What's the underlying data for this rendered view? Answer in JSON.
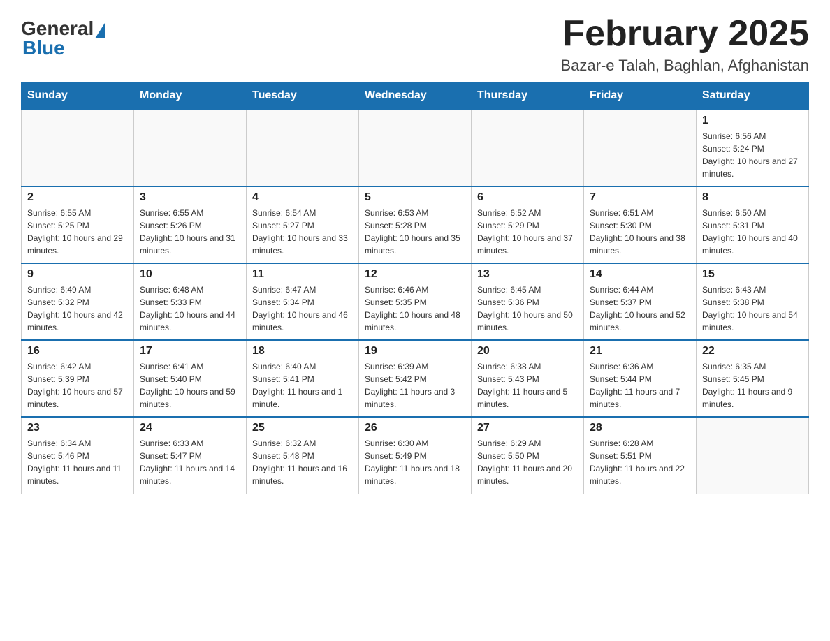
{
  "header": {
    "logo": {
      "general": "General",
      "blue": "Blue"
    },
    "title": "February 2025",
    "location": "Bazar-e Talah, Baghlan, Afghanistan"
  },
  "days_of_week": [
    "Sunday",
    "Monday",
    "Tuesday",
    "Wednesday",
    "Thursday",
    "Friday",
    "Saturday"
  ],
  "weeks": [
    [
      {
        "day": "",
        "info": ""
      },
      {
        "day": "",
        "info": ""
      },
      {
        "day": "",
        "info": ""
      },
      {
        "day": "",
        "info": ""
      },
      {
        "day": "",
        "info": ""
      },
      {
        "day": "",
        "info": ""
      },
      {
        "day": "1",
        "info": "Sunrise: 6:56 AM\nSunset: 5:24 PM\nDaylight: 10 hours and 27 minutes."
      }
    ],
    [
      {
        "day": "2",
        "info": "Sunrise: 6:55 AM\nSunset: 5:25 PM\nDaylight: 10 hours and 29 minutes."
      },
      {
        "day": "3",
        "info": "Sunrise: 6:55 AM\nSunset: 5:26 PM\nDaylight: 10 hours and 31 minutes."
      },
      {
        "day": "4",
        "info": "Sunrise: 6:54 AM\nSunset: 5:27 PM\nDaylight: 10 hours and 33 minutes."
      },
      {
        "day": "5",
        "info": "Sunrise: 6:53 AM\nSunset: 5:28 PM\nDaylight: 10 hours and 35 minutes."
      },
      {
        "day": "6",
        "info": "Sunrise: 6:52 AM\nSunset: 5:29 PM\nDaylight: 10 hours and 37 minutes."
      },
      {
        "day": "7",
        "info": "Sunrise: 6:51 AM\nSunset: 5:30 PM\nDaylight: 10 hours and 38 minutes."
      },
      {
        "day": "8",
        "info": "Sunrise: 6:50 AM\nSunset: 5:31 PM\nDaylight: 10 hours and 40 minutes."
      }
    ],
    [
      {
        "day": "9",
        "info": "Sunrise: 6:49 AM\nSunset: 5:32 PM\nDaylight: 10 hours and 42 minutes."
      },
      {
        "day": "10",
        "info": "Sunrise: 6:48 AM\nSunset: 5:33 PM\nDaylight: 10 hours and 44 minutes."
      },
      {
        "day": "11",
        "info": "Sunrise: 6:47 AM\nSunset: 5:34 PM\nDaylight: 10 hours and 46 minutes."
      },
      {
        "day": "12",
        "info": "Sunrise: 6:46 AM\nSunset: 5:35 PM\nDaylight: 10 hours and 48 minutes."
      },
      {
        "day": "13",
        "info": "Sunrise: 6:45 AM\nSunset: 5:36 PM\nDaylight: 10 hours and 50 minutes."
      },
      {
        "day": "14",
        "info": "Sunrise: 6:44 AM\nSunset: 5:37 PM\nDaylight: 10 hours and 52 minutes."
      },
      {
        "day": "15",
        "info": "Sunrise: 6:43 AM\nSunset: 5:38 PM\nDaylight: 10 hours and 54 minutes."
      }
    ],
    [
      {
        "day": "16",
        "info": "Sunrise: 6:42 AM\nSunset: 5:39 PM\nDaylight: 10 hours and 57 minutes."
      },
      {
        "day": "17",
        "info": "Sunrise: 6:41 AM\nSunset: 5:40 PM\nDaylight: 10 hours and 59 minutes."
      },
      {
        "day": "18",
        "info": "Sunrise: 6:40 AM\nSunset: 5:41 PM\nDaylight: 11 hours and 1 minute."
      },
      {
        "day": "19",
        "info": "Sunrise: 6:39 AM\nSunset: 5:42 PM\nDaylight: 11 hours and 3 minutes."
      },
      {
        "day": "20",
        "info": "Sunrise: 6:38 AM\nSunset: 5:43 PM\nDaylight: 11 hours and 5 minutes."
      },
      {
        "day": "21",
        "info": "Sunrise: 6:36 AM\nSunset: 5:44 PM\nDaylight: 11 hours and 7 minutes."
      },
      {
        "day": "22",
        "info": "Sunrise: 6:35 AM\nSunset: 5:45 PM\nDaylight: 11 hours and 9 minutes."
      }
    ],
    [
      {
        "day": "23",
        "info": "Sunrise: 6:34 AM\nSunset: 5:46 PM\nDaylight: 11 hours and 11 minutes."
      },
      {
        "day": "24",
        "info": "Sunrise: 6:33 AM\nSunset: 5:47 PM\nDaylight: 11 hours and 14 minutes."
      },
      {
        "day": "25",
        "info": "Sunrise: 6:32 AM\nSunset: 5:48 PM\nDaylight: 11 hours and 16 minutes."
      },
      {
        "day": "26",
        "info": "Sunrise: 6:30 AM\nSunset: 5:49 PM\nDaylight: 11 hours and 18 minutes."
      },
      {
        "day": "27",
        "info": "Sunrise: 6:29 AM\nSunset: 5:50 PM\nDaylight: 11 hours and 20 minutes."
      },
      {
        "day": "28",
        "info": "Sunrise: 6:28 AM\nSunset: 5:51 PM\nDaylight: 11 hours and 22 minutes."
      },
      {
        "day": "",
        "info": ""
      }
    ]
  ]
}
